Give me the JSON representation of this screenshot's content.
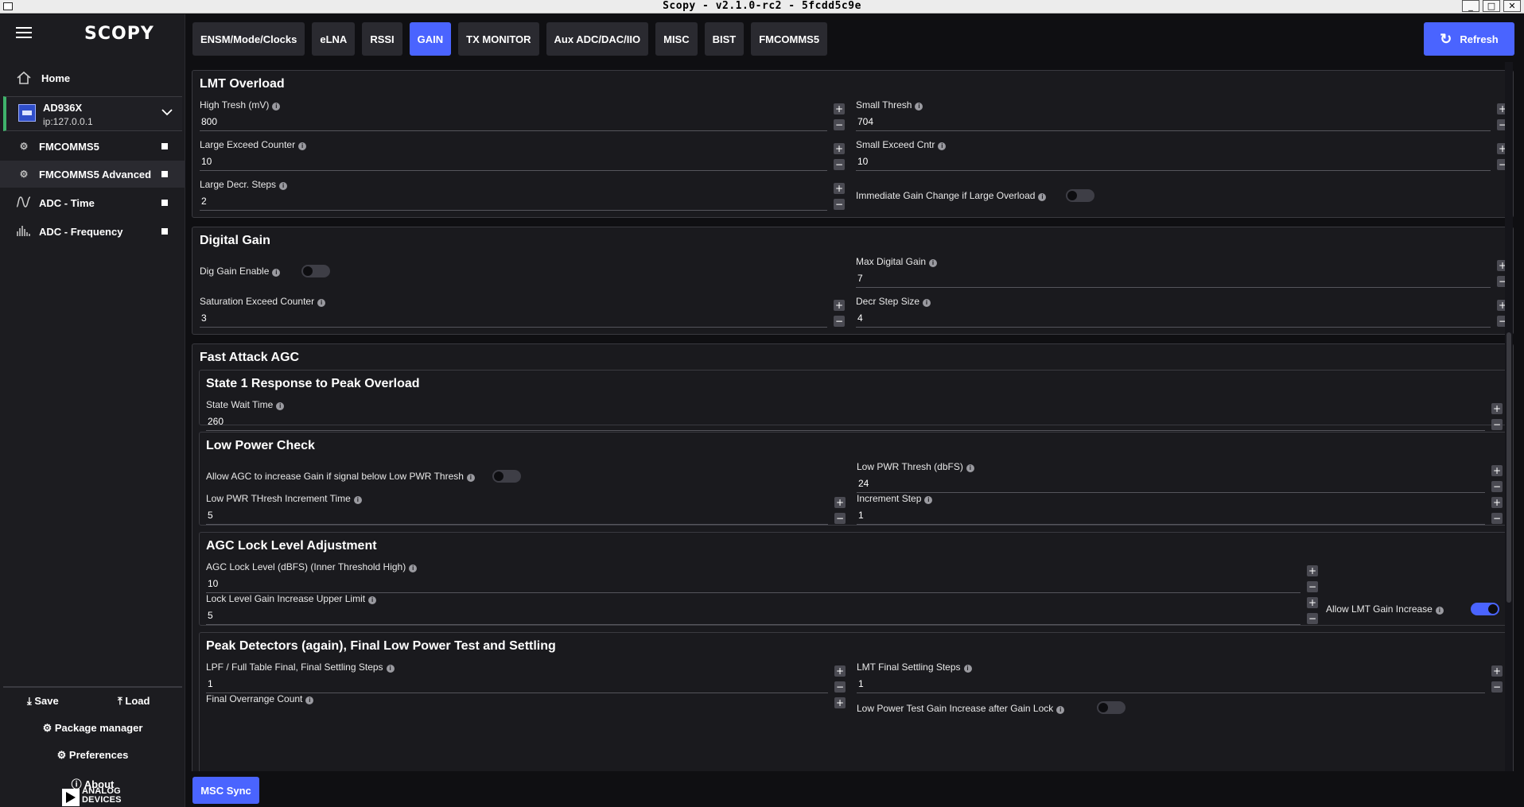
{
  "window": {
    "title": "Scopy - v2.1.0-rc2 - 5fcdd5c9e",
    "min": "_",
    "max": "□",
    "close": "✕"
  },
  "sidebar": {
    "logo": "SCOPY",
    "home": "Home",
    "device": {
      "name": "AD936X",
      "ip": "ip:127.0.0.1"
    },
    "tools": [
      "FMCOMMS5",
      "FMCOMMS5 Advanced",
      "ADC - Time",
      "ADC - Frequency"
    ],
    "save": "Save",
    "load": "Load",
    "package_manager": "Package manager",
    "preferences": "Preferences",
    "about": "About",
    "brand_line1": "ANALOG",
    "brand_line2": "DEVICES"
  },
  "tabs": [
    "ENSM/Mode/Clocks",
    "eLNA",
    "RSSI",
    "GAIN",
    "TX MONITOR",
    "Aux ADC/DAC/IIO",
    "MISC",
    "BIST",
    "FMCOMMS5"
  ],
  "active_tab": "GAIN",
  "refresh": "Refresh",
  "msc_sync": "MSC Sync",
  "lmt": {
    "title": "LMT Overload",
    "high_tresh": {
      "label": "High Tresh (mV)",
      "value": "800"
    },
    "small_thresh": {
      "label": "Small Thresh",
      "value": "704"
    },
    "large_exceed": {
      "label": "Large Exceed Counter",
      "value": "10"
    },
    "small_exceed": {
      "label": "Small Exceed Cntr",
      "value": "10"
    },
    "large_decr": {
      "label": "Large Decr. Steps",
      "value": "2"
    },
    "immediate": {
      "label": "Immediate Gain Change if Large Overload",
      "on": false
    }
  },
  "digital": {
    "title": "Digital Gain",
    "dig_enable": {
      "label": "Dig Gain Enable",
      "on": false
    },
    "max_digital": {
      "label": "Max Digital Gain",
      "value": "7"
    },
    "sat_exceed": {
      "label": "Saturation Exceed Counter",
      "value": "3"
    },
    "decr_step": {
      "label": "Decr Step Size",
      "value": "4"
    }
  },
  "agc": {
    "title": "Fast Attack AGC",
    "state1": {
      "title": "State 1 Response to Peak Overload",
      "wait": {
        "label": "State Wait Time",
        "value": "260"
      }
    },
    "lowpower": {
      "title": "Low Power Check",
      "allow": {
        "label": "Allow AGC to increase Gain if signal below Low PWR Thresh",
        "on": false
      },
      "pwr_thresh": {
        "label": "Low PWR Thresh (dbFS)",
        "value": "24"
      },
      "incr_time": {
        "label": "Low PWR THresh Increment Time",
        "value": "5"
      },
      "incr_step": {
        "label": "Increment Step",
        "value": "1"
      }
    },
    "lock": {
      "title": "AGC Lock Level Adjustment",
      "level": {
        "label": "AGC Lock Level (dBFS) (Inner Threshold High)",
        "value": "10"
      },
      "upper": {
        "label": "Lock Level Gain Increase Upper Limit",
        "value": "5"
      },
      "allow_lmt": {
        "label": "Allow LMT Gain Increase",
        "on": true
      }
    },
    "peak": {
      "title": "Peak Detectors (again), Final Low Power Test and Settling",
      "lpf": {
        "label": "LPF / Full Table Final, Final Settling Steps",
        "value": "1"
      },
      "lmt_final": {
        "label": "LMT Final Settling Steps",
        "value": "1"
      },
      "overrange": {
        "label": "Final Overrange Count"
      },
      "lp_test": {
        "label": "Low Power Test Gain Increase after Gain Lock"
      }
    }
  }
}
